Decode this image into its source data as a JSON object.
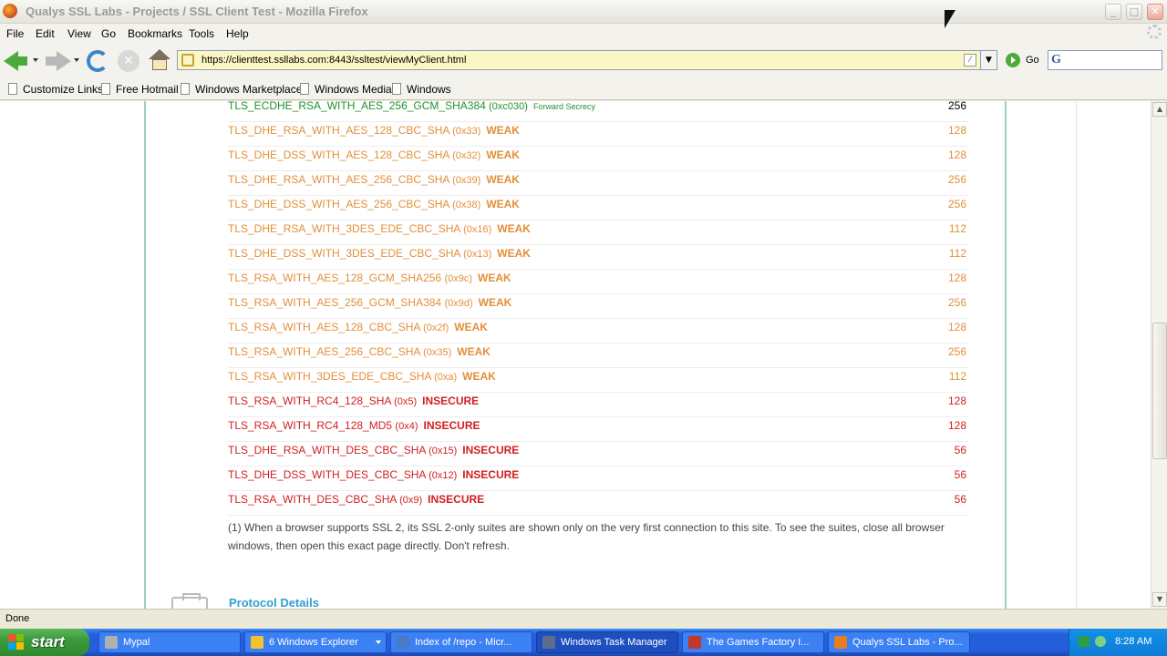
{
  "window": {
    "title": "Qualys SSL Labs - Projects / SSL Client Test - Mozilla Firefox",
    "min": "_",
    "max": "□",
    "close": "✕"
  },
  "menu": [
    "File",
    "Edit",
    "View",
    "Go",
    "Bookmarks",
    "Tools",
    "Help"
  ],
  "nav": {
    "url": "https://clienttest.ssllabs.com:8443/ssltest/viewMyClient.html",
    "go_label": "Go",
    "stop_glyph": "✕"
  },
  "bookmarks": [
    "Customize Links",
    "Free Hotmail",
    "Windows Marketplace",
    "Windows Media",
    "Windows"
  ],
  "suites": [
    {
      "name": "TLS_ECDHE_RSA_WITH_AES_256_GCM_SHA384",
      "code": "(0xc030)",
      "tag": "Forward Secrecy",
      "bits": "256",
      "level": "green"
    },
    {
      "name": "TLS_DHE_RSA_WITH_AES_128_CBC_SHA",
      "code": "(0x33)",
      "tag": "WEAK",
      "bits": "128",
      "level": "orange"
    },
    {
      "name": "TLS_DHE_DSS_WITH_AES_128_CBC_SHA",
      "code": "(0x32)",
      "tag": "WEAK",
      "bits": "128",
      "level": "orange"
    },
    {
      "name": "TLS_DHE_RSA_WITH_AES_256_CBC_SHA",
      "code": "(0x39)",
      "tag": "WEAK",
      "bits": "256",
      "level": "orange"
    },
    {
      "name": "TLS_DHE_DSS_WITH_AES_256_CBC_SHA",
      "code": "(0x38)",
      "tag": "WEAK",
      "bits": "256",
      "level": "orange"
    },
    {
      "name": "TLS_DHE_RSA_WITH_3DES_EDE_CBC_SHA",
      "code": "(0x16)",
      "tag": "WEAK",
      "bits": "112",
      "level": "orange"
    },
    {
      "name": "TLS_DHE_DSS_WITH_3DES_EDE_CBC_SHA",
      "code": "(0x13)",
      "tag": "WEAK",
      "bits": "112",
      "level": "orange"
    },
    {
      "name": "TLS_RSA_WITH_AES_128_GCM_SHA256",
      "code": "(0x9c)",
      "tag": "WEAK",
      "bits": "128",
      "level": "orange"
    },
    {
      "name": "TLS_RSA_WITH_AES_256_GCM_SHA384",
      "code": "(0x9d)",
      "tag": "WEAK",
      "bits": "256",
      "level": "orange"
    },
    {
      "name": "TLS_RSA_WITH_AES_128_CBC_SHA",
      "code": "(0x2f)",
      "tag": "WEAK",
      "bits": "128",
      "level": "orange"
    },
    {
      "name": "TLS_RSA_WITH_AES_256_CBC_SHA",
      "code": "(0x35)",
      "tag": "WEAK",
      "bits": "256",
      "level": "orange"
    },
    {
      "name": "TLS_RSA_WITH_3DES_EDE_CBC_SHA",
      "code": "(0xa)",
      "tag": "WEAK",
      "bits": "112",
      "level": "orange"
    },
    {
      "name": "TLS_RSA_WITH_RC4_128_SHA",
      "code": "(0x5)",
      "tag": "INSECURE",
      "bits": "128",
      "level": "red"
    },
    {
      "name": "TLS_RSA_WITH_RC4_128_MD5",
      "code": "(0x4)",
      "tag": "INSECURE",
      "bits": "128",
      "level": "red"
    },
    {
      "name": "TLS_DHE_RSA_WITH_DES_CBC_SHA",
      "code": "(0x15)",
      "tag": "INSECURE",
      "bits": "56",
      "level": "red"
    },
    {
      "name": "TLS_DHE_DSS_WITH_DES_CBC_SHA",
      "code": "(0x12)",
      "tag": "INSECURE",
      "bits": "56",
      "level": "red"
    },
    {
      "name": "TLS_RSA_WITH_DES_CBC_SHA",
      "code": "(0x9)",
      "tag": "INSECURE",
      "bits": "56",
      "level": "red"
    }
  ],
  "note": "(1) When a browser supports SSL 2, its SSL 2-only suites are shown only on the very first connection to this site. To see the suites, close all browser windows, then open this exact page directly. Don't refresh.",
  "section_title": "Protocol Details",
  "status": "Done",
  "taskbar": {
    "start": "start",
    "tasks": [
      {
        "label": "Mypal",
        "active": false,
        "has_dropdown": false
      },
      {
        "label": "6 Windows Explorer",
        "active": false,
        "has_dropdown": true
      },
      {
        "label": "Index of /repo - Micr...",
        "active": false,
        "has_dropdown": false
      },
      {
        "label": "Windows Task Manager",
        "active": true,
        "has_dropdown": false
      },
      {
        "label": "The Games Factory I...",
        "active": false,
        "has_dropdown": false
      },
      {
        "label": "Qualys SSL Labs - Pro...",
        "active": false,
        "has_dropdown": false
      }
    ],
    "clock": "8:28 AM"
  },
  "colors": {
    "green": "#22912d",
    "orange": "#e28f3a",
    "red": "#d21f20",
    "link": "#2f9fd0",
    "panel_border": "#9fcdc7",
    "taskbar": "#245edb"
  }
}
